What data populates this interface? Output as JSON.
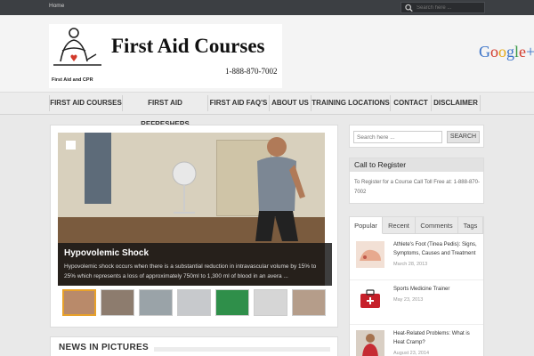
{
  "topbar": {
    "home_label": "Home",
    "search_placeholder": "Search here ..."
  },
  "header": {
    "logo_title": "First Aid Courses",
    "logo_subtitle": "First Aid and CPR",
    "phone": "1-888-870-7002",
    "google_plus_label": "Google+"
  },
  "nav": {
    "items": [
      "FIRST AID COURSES",
      "FIRST AID REFRESHERS",
      "FIRST AID FAQ'S",
      "ABOUT US",
      "TRAINING LOCATIONS",
      "CONTACT",
      "DISCLAIMER"
    ]
  },
  "slider": {
    "title": "Hypovolemic Shock",
    "excerpt": "Hypovolemic shock occurs when there is a substantial reduction in intravascular volume by 15% to 25% which represents a loss of approximately 750ml to 1,300 ml of blood in an avera ...",
    "thumbnail_colors": [
      "#b98a6a",
      "#8d7c6e",
      "#9aa3a8",
      "#c7c9cc",
      "#2f8f4a",
      "#d6d6d6",
      "#b59d8a"
    ]
  },
  "news": {
    "title": "NEWS IN PICTURES"
  },
  "sidebar": {
    "search_placeholder": "Search here ...",
    "search_button": "SEARCH",
    "call_title": "Call to Register",
    "call_text": "To Register for a Course Call Toll Free at: 1-888-870-7002",
    "tabs": [
      "Popular",
      "Recent",
      "Comments",
      "Tags"
    ],
    "posts": [
      {
        "title": "Athlete's Foot (Tinea Pedis): Signs, Symptoms, Causes and Treatment",
        "date": "March 28, 2013"
      },
      {
        "title": "Sports Medicine Trainer",
        "date": "May 23, 2013"
      },
      {
        "title": "Heat-Related Problems: What is Heat Cramp?",
        "date": "August 23, 2014"
      }
    ]
  },
  "colors": {
    "topbar": "#3c3f43",
    "accent": "#e8a12a",
    "google_blue": "#3b73c8",
    "google_red": "#d2392b",
    "google_yellow": "#e5a814",
    "google_green": "#3a9a47"
  }
}
